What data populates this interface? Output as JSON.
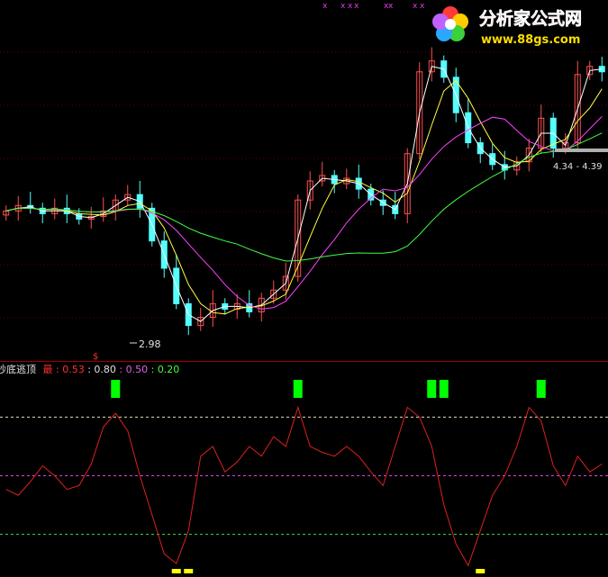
{
  "watermark": {
    "title": "分析家公式网",
    "url": "www.88gs.com"
  },
  "indicator": {
    "name_partial": "抄底逃顶",
    "label": "最",
    "values": [
      "0.53",
      "0.80",
      "0.50",
      "0.20"
    ],
    "value_colors": [
      "#ff3030",
      "#e0e0e0",
      "#e060e0",
      "#40ff40"
    ]
  },
  "annotations": {
    "low_price": "2.98",
    "range_price": "4.34 - 4.39",
    "dollar_marker": "$"
  },
  "colors": {
    "background": "#000000",
    "grid": "#5a0000",
    "separator": "#a00000",
    "up_candle": "#ff5050",
    "down_candle": "#54ffff",
    "ma_short": "#ffffff",
    "ma_mid": "#ffff40",
    "ma_long": "#ff40ff",
    "ma_longest": "#40ff40",
    "osc_line": "#dd2020",
    "top_signal": "#00ff00",
    "bottom_signal": "#ffff00",
    "dashed_high": "#e0e0c0",
    "dashed_mid": "#e040e0",
    "dashed_low": "#40e040"
  },
  "chart_data": [
    {
      "type": "candlestick",
      "title": "",
      "panel": "price",
      "y_range": [
        2.8,
        5.4
      ],
      "closes": [
        3.88,
        3.92,
        3.9,
        3.86,
        3.9,
        3.86,
        3.82,
        3.84,
        3.88,
        3.96,
        4.0,
        3.9,
        3.66,
        3.46,
        3.2,
        3.04,
        3.1,
        3.2,
        3.16,
        3.2,
        3.14,
        3.24,
        3.3,
        3.4,
        3.96,
        4.1,
        4.14,
        4.08,
        4.12,
        4.04,
        3.96,
        3.92,
        3.86,
        4.3,
        4.9,
        4.98,
        4.86,
        4.6,
        4.38,
        4.3,
        4.22,
        4.18,
        4.24,
        4.34,
        4.56,
        4.34,
        4.38,
        4.88,
        4.94,
        4.9
      ],
      "moving_averages": [
        "white",
        "yellow",
        "magenta",
        "green"
      ],
      "annotations": [
        {
          "label": "2.98",
          "value": 2.98
        },
        {
          "label": "4.34 - 4.39",
          "value": 4.36
        }
      ]
    },
    {
      "type": "line",
      "title": "抄底逃顶",
      "panel": "oscillator",
      "y_range": [
        0,
        1
      ],
      "reference_lines": [
        0.8,
        0.5,
        0.2
      ],
      "values": [
        0.43,
        0.4,
        0.47,
        0.55,
        0.5,
        0.43,
        0.45,
        0.56,
        0.75,
        0.82,
        0.73,
        0.5,
        0.3,
        0.1,
        0.05,
        0.22,
        0.6,
        0.65,
        0.52,
        0.57,
        0.65,
        0.6,
        0.7,
        0.65,
        0.85,
        0.65,
        0.62,
        0.6,
        0.65,
        0.6,
        0.52,
        0.45,
        0.65,
        0.85,
        0.8,
        0.65,
        0.35,
        0.15,
        0.04,
        0.22,
        0.4,
        0.5,
        0.65,
        0.85,
        0.78,
        0.55,
        0.45,
        0.6,
        0.52,
        0.56
      ],
      "top_signals": [
        9,
        24,
        35,
        36,
        44
      ],
      "bottom_signals": [
        14,
        15,
        39
      ]
    }
  ]
}
